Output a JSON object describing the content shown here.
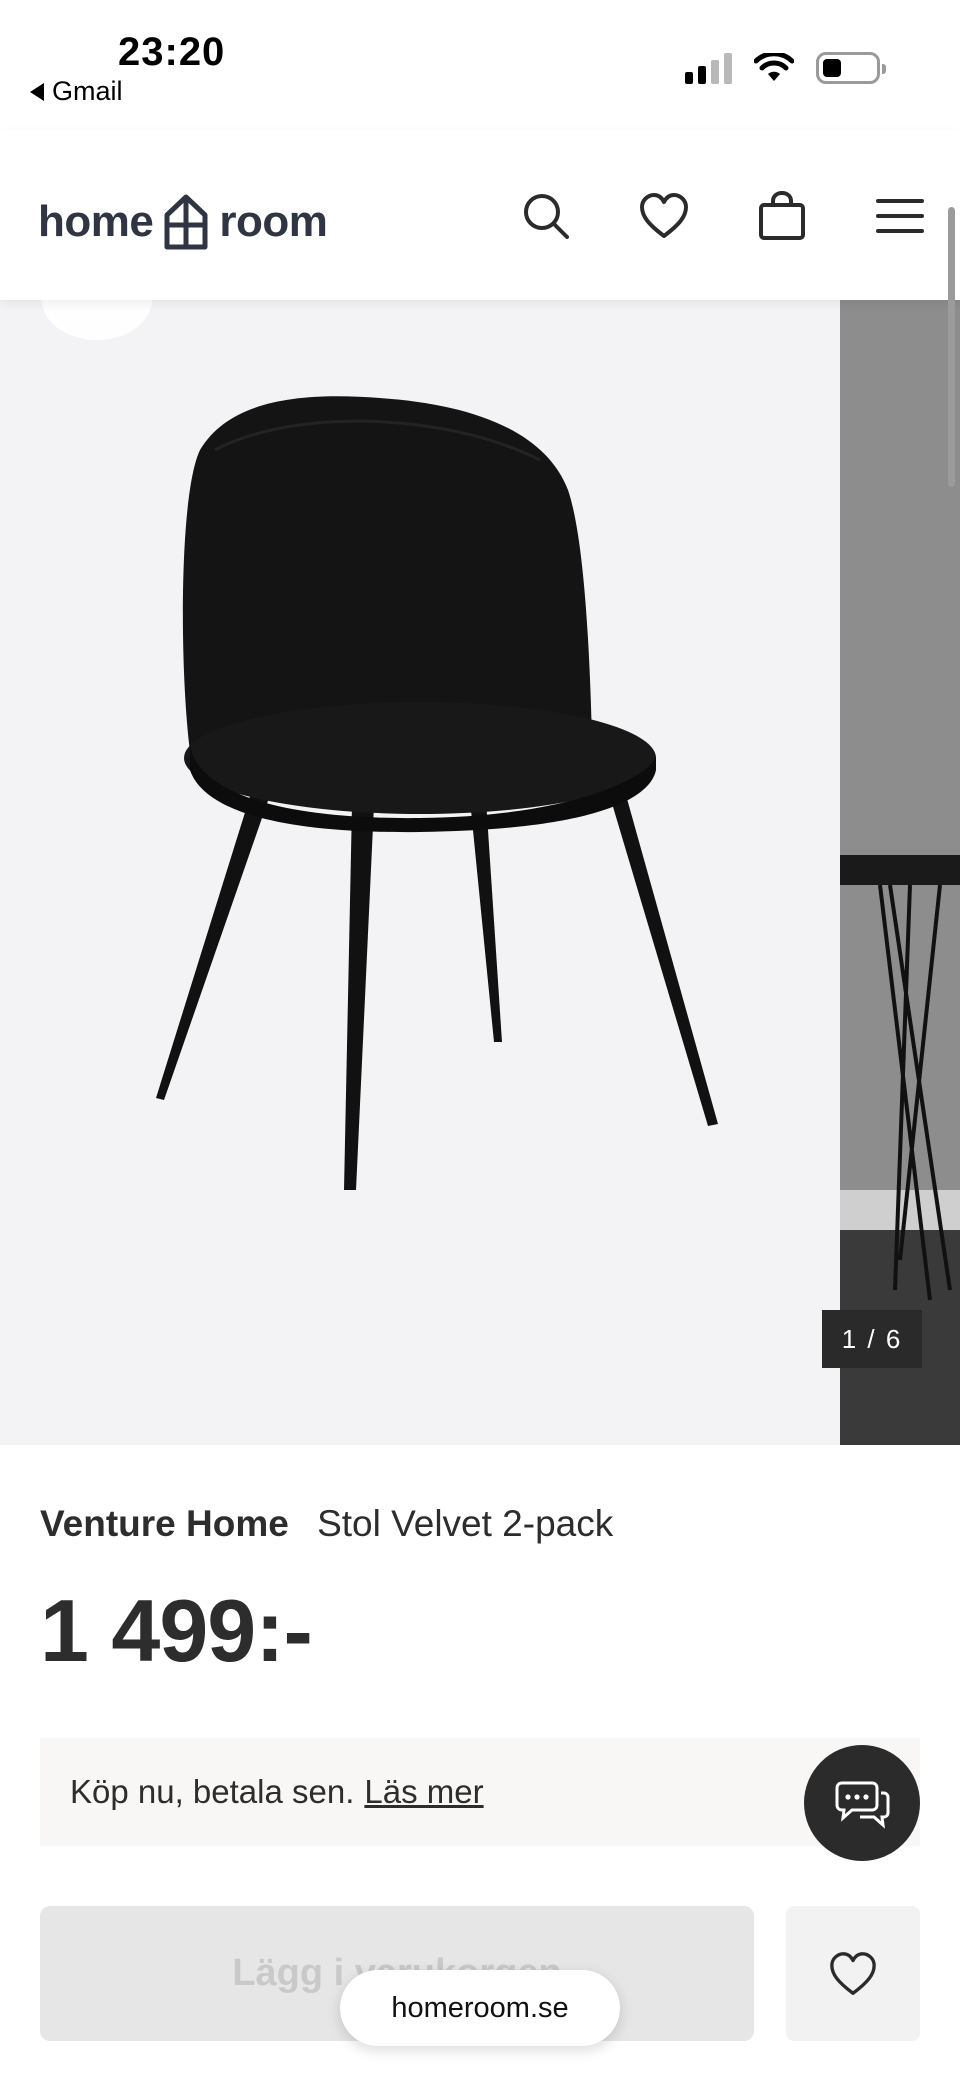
{
  "status_bar": {
    "time": "23:20",
    "back_app": "Gmail",
    "signal_bars_active": 2,
    "signal_bars_total": 4,
    "battery_level_fraction": 0.25
  },
  "header": {
    "logo_left": "home",
    "logo_right": "room",
    "icons": [
      "search-icon",
      "heart-icon",
      "shopping-bag-icon",
      "menu-icon"
    ]
  },
  "gallery": {
    "counter": "1 / 6",
    "current_index": 1,
    "total": 6
  },
  "product": {
    "brand": "Venture Home",
    "name": "Stol Velvet 2-pack",
    "price": "1 499:-"
  },
  "financing": {
    "text": "Köp nu, betala sen.",
    "link": "Läs mer"
  },
  "actions": {
    "add_to_cart": "Lägg i varukorgen",
    "add_to_cart_disabled": true
  },
  "browser": {
    "url": "homeroom.se"
  },
  "colors": {
    "text_dark": "#2d2d2d",
    "logo": "#2f3542",
    "gallery_bg": "#f3f3f5",
    "financing_bg": "#f8f7f5",
    "button_disabled_bg": "#e6e6e6",
    "counter_bg": "#2a2a2a"
  }
}
